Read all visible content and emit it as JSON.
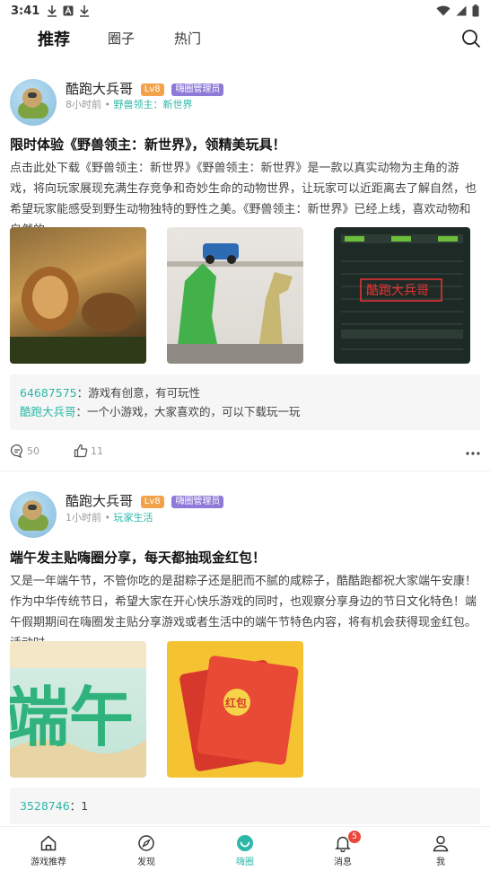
{
  "status_bar": {
    "time": "3:41"
  },
  "top_nav": {
    "tabs": [
      {
        "label": "推荐",
        "active": true
      },
      {
        "label": "圈子",
        "active": false
      },
      {
        "label": "热门",
        "active": false
      }
    ]
  },
  "posts": [
    {
      "author": "酷跑大兵哥",
      "level": "Lv8",
      "role": "嗨圈管理员",
      "time": "8小时前",
      "separator": "•",
      "circle": "野兽领主：新世界",
      "title": "限时体验《野兽领主：新世界》，领精美玩具！",
      "body": "点击此处下载《野兽领主：新世界》《野兽领主：新世界》是一款以真实动物为主角的游戏，将向玩家展现充满生存竞争和奇妙生命的动物世界，让玩家可以近距离去了解自然，也希望玩家能感受到野生动物独特的野性之美。《野兽领主：新世界》已经上线，喜欢动物和自然的…",
      "image_caption": "酷跑大兵哥",
      "comments": [
        {
          "user": "64687575",
          "sep": "：",
          "text": "游戏有创意，有可玩性"
        },
        {
          "user": "酷跑大兵哥",
          "sep": "：",
          "text": "一个小游戏，大家喜欢的，可以下载玩一玩"
        }
      ],
      "comment_count": "50",
      "like_count": "11"
    },
    {
      "author": "酷跑大兵哥",
      "level": "Lv8",
      "role": "嗨圈管理员",
      "time": "1小时前",
      "separator": "•",
      "circle": "玩家生活",
      "title": "端午发主贴嗨圈分享，每天都抽现金红包！",
      "body": "又是一年端午节，不管你吃的是甜粽子还是肥而不腻的咸粽子，酷酷跑都祝大家端午安康！作为中华传统节日，希望大家在开心快乐游戏的同时，也观察分享身边的节日文化特色！端午假期期间在嗨圈发主贴分享游戏或者生活中的端午节特色内容，将有机会获得现金红包。活动时…",
      "image_text_1": "端午",
      "image_text_2": "红包",
      "comments": [
        {
          "user": "3528746",
          "sep": "：",
          "text": "1"
        }
      ]
    }
  ],
  "bottom_nav": {
    "items": [
      {
        "label": "游戏推荐",
        "active": false
      },
      {
        "label": "发现",
        "active": false
      },
      {
        "label": "嗨圈",
        "active": true
      },
      {
        "label": "消息",
        "active": false,
        "badge": "5"
      },
      {
        "label": "我",
        "active": false
      }
    ]
  },
  "colors": {
    "accent": "#2db7a8",
    "level_badge": "#f2a24a",
    "role_badge": "#8e7ad8",
    "notification": "#e9473c"
  }
}
